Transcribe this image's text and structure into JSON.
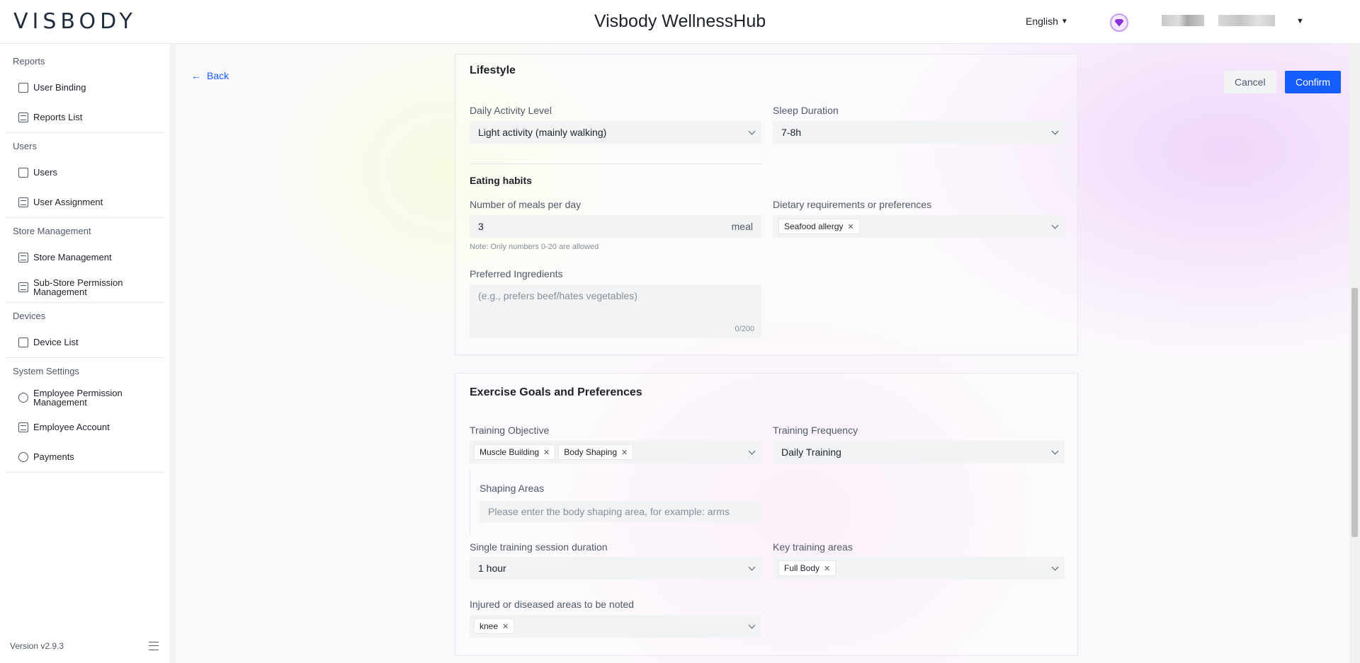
{
  "header": {
    "logo": "VISBODY",
    "title": "Visbody WellnessHub",
    "language": "English"
  },
  "sidebar": {
    "groups": [
      {
        "label": "Reports",
        "items": [
          {
            "label": "User Binding"
          },
          {
            "label": "Reports List"
          }
        ]
      },
      {
        "label": "Users",
        "items": [
          {
            "label": "Users"
          },
          {
            "label": "User Assignment"
          }
        ]
      },
      {
        "label": "Store Management",
        "items": [
          {
            "label": "Store Management"
          },
          {
            "label": "Sub-Store Permission Management"
          }
        ]
      },
      {
        "label": "Devices",
        "items": [
          {
            "label": "Device List"
          }
        ]
      },
      {
        "label": "System Settings",
        "items": [
          {
            "label": "Employee Permission Management"
          },
          {
            "label": "Employee Account"
          },
          {
            "label": "Payments"
          }
        ]
      }
    ],
    "version": "Version v2.9.3"
  },
  "main": {
    "back_label": "Back",
    "cancel_label": "Cancel",
    "confirm_label": "Confirm",
    "lifestyle": {
      "title": "Lifestyle",
      "daily_activity_label": "Daily Activity Level",
      "daily_activity_value": "Light activity (mainly walking)",
      "sleep_label": "Sleep Duration",
      "sleep_value": "7-8h",
      "eating_habits_title": "Eating habits",
      "meals_label": "Number of meals per day",
      "meals_value": "3",
      "meals_unit": "meal",
      "meals_note": "Note: Only numbers 0-20 are allowed",
      "dietary_label": "Dietary requirements or preferences",
      "dietary_tags": [
        "Seafood allergy"
      ],
      "ingredients_label": "Preferred Ingredients",
      "ingredients_placeholder": "(e.g., prefers beef/hates vegetables)",
      "ingredients_counter": "0/200"
    },
    "exercise": {
      "title": "Exercise Goals and Preferences",
      "objective_label": "Training Objective",
      "objective_tags": [
        "Muscle Building",
        "Body Shaping"
      ],
      "frequency_label": "Training Frequency",
      "frequency_value": "Daily Training",
      "shaping_label": "Shaping Areas",
      "shaping_placeholder": "Please enter the body shaping area, for example: arms",
      "duration_label": "Single training session duration",
      "duration_value": "1 hour",
      "key_areas_label": "Key training areas",
      "key_areas_tags": [
        "Full Body"
      ],
      "injured_label": "Injured or diseased areas to be noted",
      "injured_tags": [
        "knee"
      ]
    }
  }
}
